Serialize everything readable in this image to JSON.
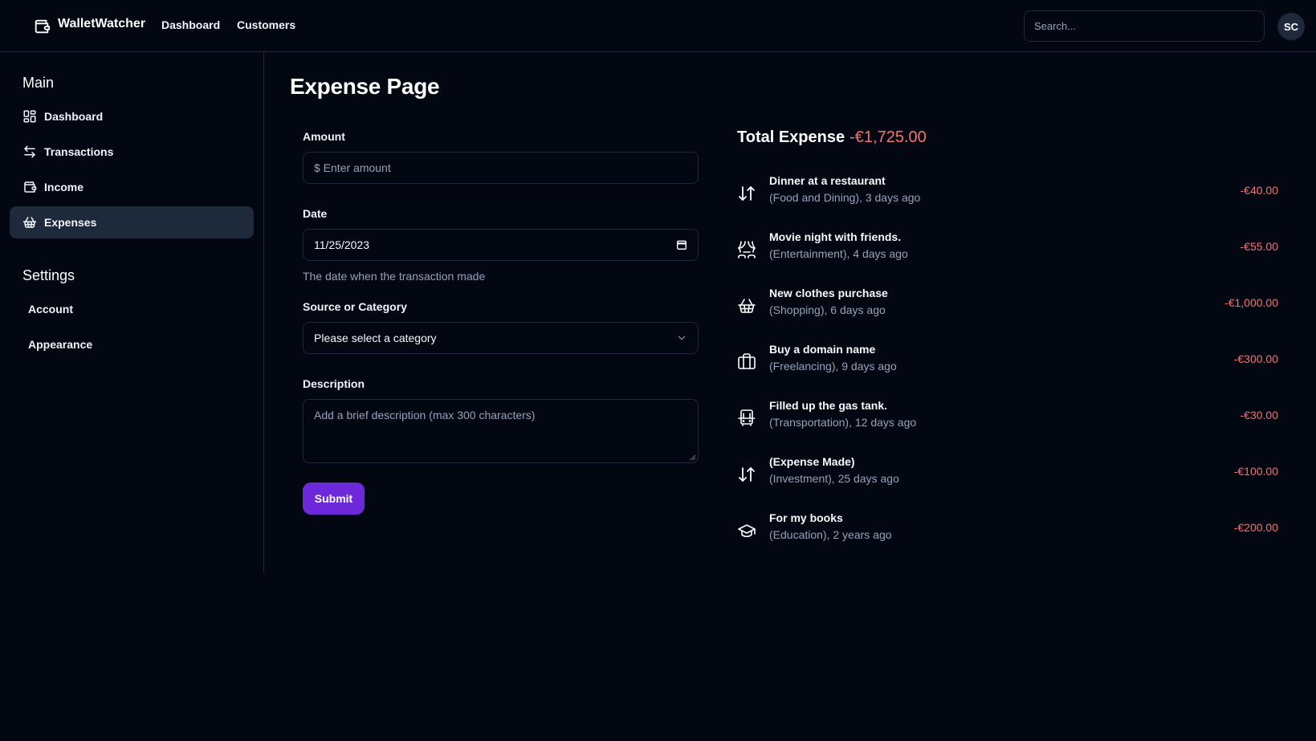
{
  "header": {
    "app_title": "WalletWatcher",
    "nav": [
      "Dashboard",
      "Customers"
    ],
    "search_placeholder": "Search...",
    "avatar_initials": "SC"
  },
  "sidebar": {
    "main_heading": "Main",
    "items": [
      {
        "label": "Dashboard",
        "icon": "dashboard-grid-icon"
      },
      {
        "label": "Transactions",
        "icon": "arrows-left-right-icon"
      },
      {
        "label": "Income",
        "icon": "wallet-icon"
      },
      {
        "label": "Expenses",
        "icon": "basket-icon",
        "active": true
      }
    ],
    "settings_heading": "Settings",
    "settings_items": [
      "Account",
      "Appearance"
    ]
  },
  "main": {
    "page_title": "Expense Page",
    "form": {
      "amount_label": "Amount",
      "amount_placeholder": "$ Enter amount",
      "date_label": "Date",
      "date_value": "11/25/2023",
      "date_help": "The date when the transaction made",
      "category_label": "Source or Category",
      "category_value": "Please select a category",
      "description_label": "Description",
      "description_placeholder": "Add a brief description (max 300 characters)",
      "submit_label": "Submit"
    }
  },
  "summary": {
    "total_label": "Total Expense",
    "total_value": "-€1,725.00",
    "accent_color": "#f87171",
    "transactions": [
      {
        "title": "Dinner at a restaurant",
        "sub": "(Food and Dining), 3 days ago",
        "amount": "-€40.00",
        "icon": "arrows-up-down-icon"
      },
      {
        "title": "Movie night with friends.",
        "sub": "(Entertainment), 4 days ago",
        "amount": "-€55.00",
        "icon": "theater-masks-icon"
      },
      {
        "title": "New clothes purchase",
        "sub": "(Shopping), 6 days ago",
        "amount": "-€1,000.00",
        "icon": "basket-icon"
      },
      {
        "title": "Buy a domain name",
        "sub": "(Freelancing), 9 days ago",
        "amount": "-€300.00",
        "icon": "briefcase-icon"
      },
      {
        "title": "Filled up the gas tank.",
        "sub": "(Transportation), 12 days ago",
        "amount": "-€30.00",
        "icon": "bus-icon"
      },
      {
        "title": "(Expense Made)",
        "sub": "(Investment), 25 days ago",
        "amount": "-€100.00",
        "icon": "arrows-up-down-icon"
      },
      {
        "title": "For my books",
        "sub": "(Education), 2 years ago",
        "amount": "-€200.00",
        "icon": "graduation-cap-icon"
      }
    ]
  }
}
